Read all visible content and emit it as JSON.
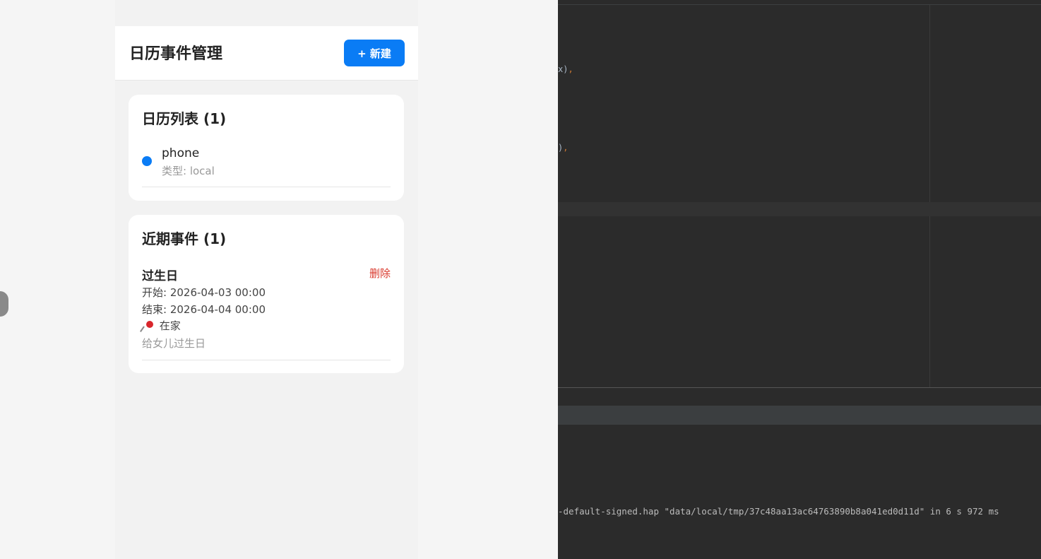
{
  "app": {
    "title": "日历事件管理",
    "new_button": "+ 新建"
  },
  "calendars": {
    "heading": "日历列表 (1)",
    "items": [
      {
        "name": "phone",
        "type": "类型: local",
        "color": "#0a7cf5"
      }
    ]
  },
  "events": {
    "heading": "近期事件 (1)",
    "items": [
      {
        "title": "过生日",
        "delete_label": "删除",
        "start": "开始: 2026-04-03 00:00",
        "end": "结束: 2026-04-04 00:00",
        "location": "在家",
        "location_icon": "pushpin-icon",
        "description": "给女儿过生日"
      }
    ]
  },
  "ide": {
    "frag1": "x)",
    "frag2": ")",
    "console": "-default-signed.hap \"data/local/tmp/37c48aa13ac64763890b8a041ed0d11d\" in 6 s 972 ms"
  },
  "colors": {
    "accent": "#0a7cf5",
    "danger": "#d9382c",
    "ide_bg": "#2b2b2b"
  }
}
